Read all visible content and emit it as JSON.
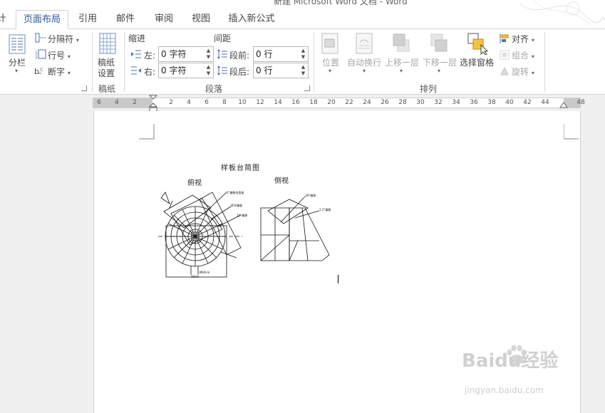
{
  "window": {
    "title": "新建 Microsoft Word 文档 - Word"
  },
  "tabs": [
    {
      "label": "计",
      "active": false
    },
    {
      "label": "页面布局",
      "active": true
    },
    {
      "label": "引用",
      "active": false
    },
    {
      "label": "邮件",
      "active": false
    },
    {
      "label": "审阅",
      "active": false
    },
    {
      "label": "视图",
      "active": false
    },
    {
      "label": "插入新公式",
      "active": false
    }
  ],
  "ribbon": {
    "columns_label": "分栏",
    "breaks_label": "分隔符",
    "line_numbers_label": "行号",
    "hyphenation_label": "断字",
    "draft_label_1": "稿纸",
    "draft_label_2": "设置",
    "draft_group": "稿纸",
    "indent_header": "缩进",
    "spacing_header": "间距",
    "indent_left_label": "左:",
    "indent_left_value": "0 字符",
    "indent_right_label": "右:",
    "indent_right_value": "0 字符",
    "space_before_label": "段前:",
    "space_before_value": "0 行",
    "space_after_label": "段后:",
    "space_after_value": "0 行",
    "paragraph_group": "段落",
    "position_label": "位置",
    "wrap_text_label": "自动换行",
    "bring_forward_label": "上移一层",
    "send_backward_label": "下移一层",
    "selection_pane_label": "选择窗格",
    "align_label": "对齐",
    "group_label": "组合",
    "rotate_label": "旋转",
    "arrange_group": "排列"
  },
  "ruler": {
    "left_numbers": [
      "6",
      "4",
      "2"
    ],
    "right_numbers": [
      "2",
      "4",
      "6",
      "8",
      "10",
      "12",
      "14",
      "16",
      "18",
      "20",
      "22",
      "24",
      "26",
      "28",
      "30",
      "32",
      "34",
      "36",
      "38",
      "40",
      "42",
      "44",
      "48"
    ]
  },
  "document": {
    "figure_title": "样板台简图",
    "top_view_label": "俯视",
    "side_view_label": "侧视",
    "tiny_labels": {
      "t1": "5°偏移台面板",
      "t2": "Ø10偏板",
      "t3": "10°偏移",
      "t4": "10cm",
      "t5": "Ø60cm",
      "t6": "18°偏移",
      "t7": "1.2°偏移"
    }
  },
  "watermark": {
    "brand": "Baidu经验",
    "url": "jingyan.baidu.com"
  }
}
